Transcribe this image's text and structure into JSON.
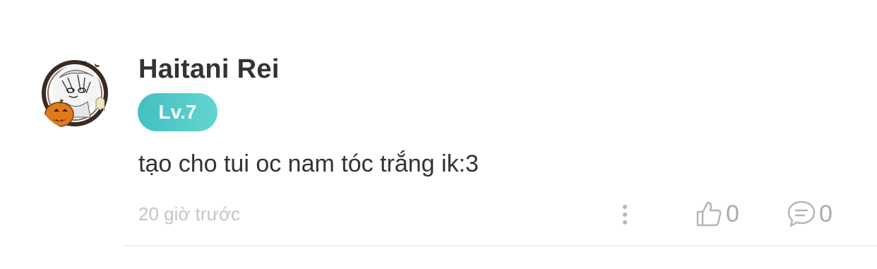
{
  "comment": {
    "username": "Haitani Rei",
    "level": "Lv.7",
    "text": "tạo cho tui oc nam tóc trắng ik:3",
    "timestamp": "20 giờ trước",
    "like_count": "0",
    "reply_count": "0"
  },
  "icons": {
    "avatar": "user-avatar-halloween",
    "more": "more-vertical-icon",
    "like": "thumbs-up-icon",
    "reply": "comment-bubble-icon"
  },
  "colors": {
    "badge_start": "#45bfc3",
    "badge_end": "#62d5cf",
    "username": "#333333",
    "meta": "#c4c4c4",
    "icon": "#b5b5b5"
  }
}
